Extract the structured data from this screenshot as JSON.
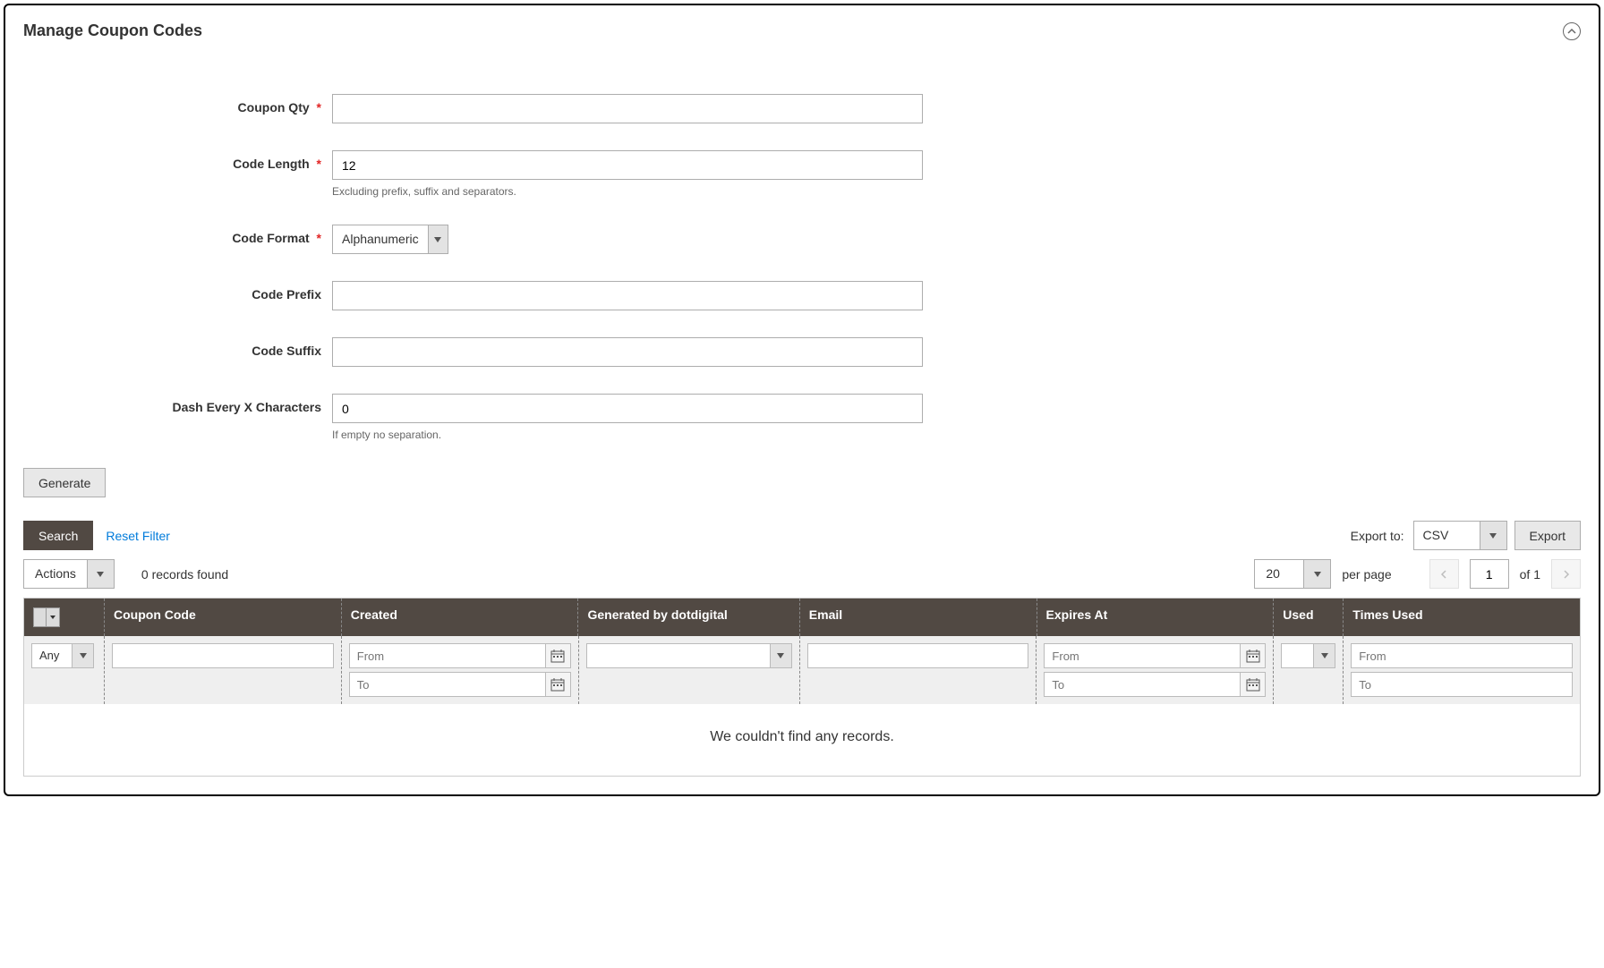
{
  "panel": {
    "title": "Manage Coupon Codes"
  },
  "form": {
    "coupon_qty": {
      "label": "Coupon Qty",
      "required": true,
      "value": ""
    },
    "code_length": {
      "label": "Code Length",
      "required": true,
      "value": "12",
      "hint": "Excluding prefix, suffix and separators."
    },
    "code_format": {
      "label": "Code Format",
      "required": true,
      "value": "Alphanumeric"
    },
    "code_prefix": {
      "label": "Code Prefix",
      "required": false,
      "value": ""
    },
    "code_suffix": {
      "label": "Code Suffix",
      "required": false,
      "value": ""
    },
    "dash_every": {
      "label": "Dash Every X Characters",
      "required": false,
      "value": "0",
      "hint": "If empty no separation."
    }
  },
  "buttons": {
    "generate": "Generate",
    "search": "Search",
    "reset_filter": "Reset Filter",
    "export_to_label": "Export to:",
    "export_format": "CSV",
    "export": "Export",
    "actions": "Actions"
  },
  "grid_toolbar": {
    "records_found": "0 records found",
    "per_page_value": "20",
    "per_page_label": "per page",
    "page_current": "1",
    "page_total_label": "of 1"
  },
  "grid": {
    "columns": {
      "coupon_code": "Coupon Code",
      "created": "Created",
      "generated_by": "Generated by dotdigital",
      "email": "Email",
      "expires_at": "Expires At",
      "used": "Used",
      "times_used": "Times Used"
    },
    "filters": {
      "any": "Any",
      "from": "From",
      "to": "To"
    },
    "empty": "We couldn't find any records."
  }
}
